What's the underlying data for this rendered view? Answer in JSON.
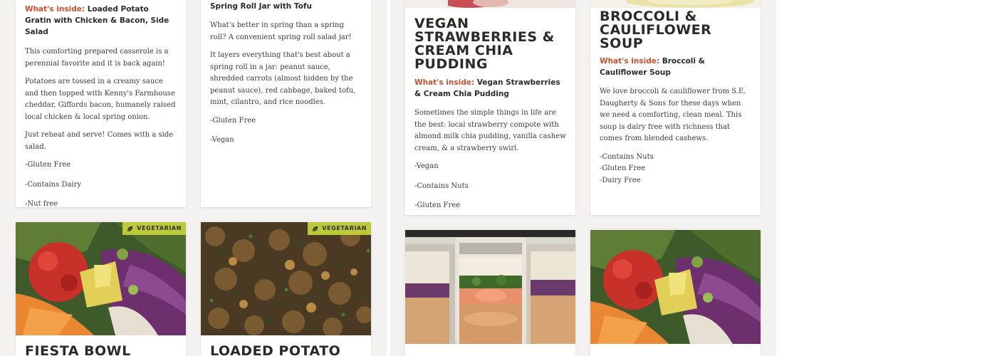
{
  "cards_top": [
    {
      "inside_label": "What's inside:",
      "inside_value": "Loaded Potato Gratin with Chicken & Bacon, Side Salad",
      "paragraphs": [
        "This comforting prepared casserole is a perennial favorite and it is back again!",
        "Potatoes are tossed in a creamy sauce and then topped with Kenny's Farmhouse cheddar, Giffords bacon, humanely raised local chicken & local spring onion.",
        "Just reheat and serve! Comes with a side salad."
      ],
      "tags": [
        "-Gluten Free",
        "-Contains Dairy",
        "-Nut free"
      ]
    },
    {
      "inside_value": "Spring Roll Jar with Tofu",
      "paragraphs": [
        "What's better in spring than a spring roll? A convenient spring roll salad jar!",
        "It layers everything that's best about a spring roll in a jar: peanut sauce, shredded carrots (almost hidden by the peanut sauce), red cabbage, baked tofu, mint, cilantro, and rice noodles."
      ],
      "tags": [
        "-Gluten Free",
        "-Vegan"
      ]
    },
    {
      "title": "VEGAN STRAWBERRIES & CREAM CHIA PUDDING",
      "inside_label": "What's inside:",
      "inside_value": "Vegan Strawberries & Cream Chia Pudding",
      "paragraphs": [
        "Sometimes the simple things in life are the best: local strawberry compote with almond milk chia pudding, vanilla cashew cream, & a strawberry swirl."
      ],
      "tags": [
        "-Vegan",
        "-Contains Nuts",
        "-Gluten Free"
      ]
    },
    {
      "title": "BROCCOLI & CAULIFLOWER SOUP",
      "inside_label": "What's inside:",
      "inside_value": "Broccoli & Cauliflower Soup",
      "paragraphs": [
        "We love broccoli & cauliflower from S.E. Daugherty & Sons for these days when we need a comforting, clean meal. This soup is dairy free with richness that comes from blended cashews."
      ],
      "tags": [
        "-Contains Nuts",
        "-Gluten Free",
        "-Dairy Free"
      ]
    }
  ],
  "cards_bottom": [
    {
      "badge": "VEGETARIAN",
      "title": "FIESTA BOWL WITH",
      "photo": "fiesta-bowl"
    },
    {
      "badge": "VEGETARIAN",
      "title": "LOADED POTATO GRATIN",
      "photo": "potato-gratin"
    },
    {
      "photo": "spring-roll-jars"
    },
    {
      "photo": "fiesta-bowl"
    }
  ],
  "colors": {
    "accent": "#c9502f",
    "badge": "#bcc93a",
    "background": "#f3f2f0"
  },
  "icons": {
    "badge_icon": "leaf-icon"
  }
}
